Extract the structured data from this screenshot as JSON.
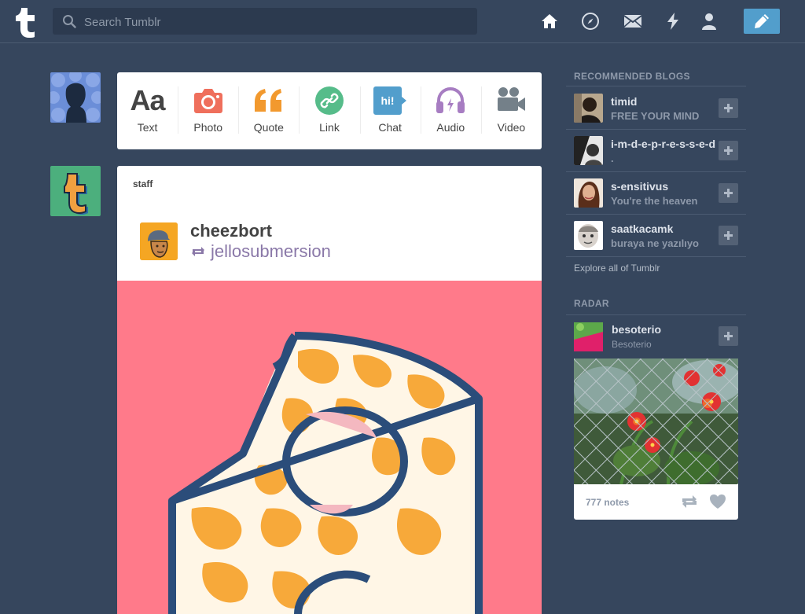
{
  "search": {
    "placeholder": "Search Tumblr"
  },
  "nav": {
    "icons": [
      "home-icon",
      "explore-compass-icon",
      "inbox-mail-icon",
      "activity-lightning-icon",
      "account-person-icon"
    ],
    "compose_icon": "pencil-icon"
  },
  "post_types": [
    {
      "label": "Text",
      "icon": "text-aa-icon",
      "color": "#444444"
    },
    {
      "label": "Photo",
      "icon": "camera-icon",
      "color": "#ef6f5c"
    },
    {
      "label": "Quote",
      "icon": "quote-icon",
      "color": "#f2992e"
    },
    {
      "label": "Link",
      "icon": "link-icon",
      "color": "#56bc8a"
    },
    {
      "label": "Chat",
      "icon": "chat-icon",
      "color": "#529ecc"
    },
    {
      "label": "Audio",
      "icon": "headphones-icon",
      "color": "#a77dc2"
    },
    {
      "label": "Video",
      "icon": "video-camera-icon",
      "color": "#748089"
    }
  ],
  "post": {
    "author": "staff",
    "reblogger": "cheezbort",
    "source": "jellosubmersion"
  },
  "sidebar": {
    "recommended_title": "RECOMMENDED BLOGS",
    "blogs": [
      {
        "name": "timid",
        "desc": "FREE YOUR MIND"
      },
      {
        "name": "i-m-d-e-p-r-e-s-s-e-d",
        "desc": "."
      },
      {
        "name": "s-ensitivus",
        "desc": "You're the heaven"
      },
      {
        "name": "saatkacamk",
        "desc": "buraya ne yazılıyo"
      }
    ],
    "explore_label": "Explore all of Tumblr",
    "radar_title": "RADAR",
    "radar": {
      "name": "besoterio",
      "desc": "Besoterio",
      "notes": "777 notes"
    }
  },
  "colors": {
    "background": "#36465d",
    "accent": "#529ecc",
    "post_image": "#ff7a8a"
  }
}
